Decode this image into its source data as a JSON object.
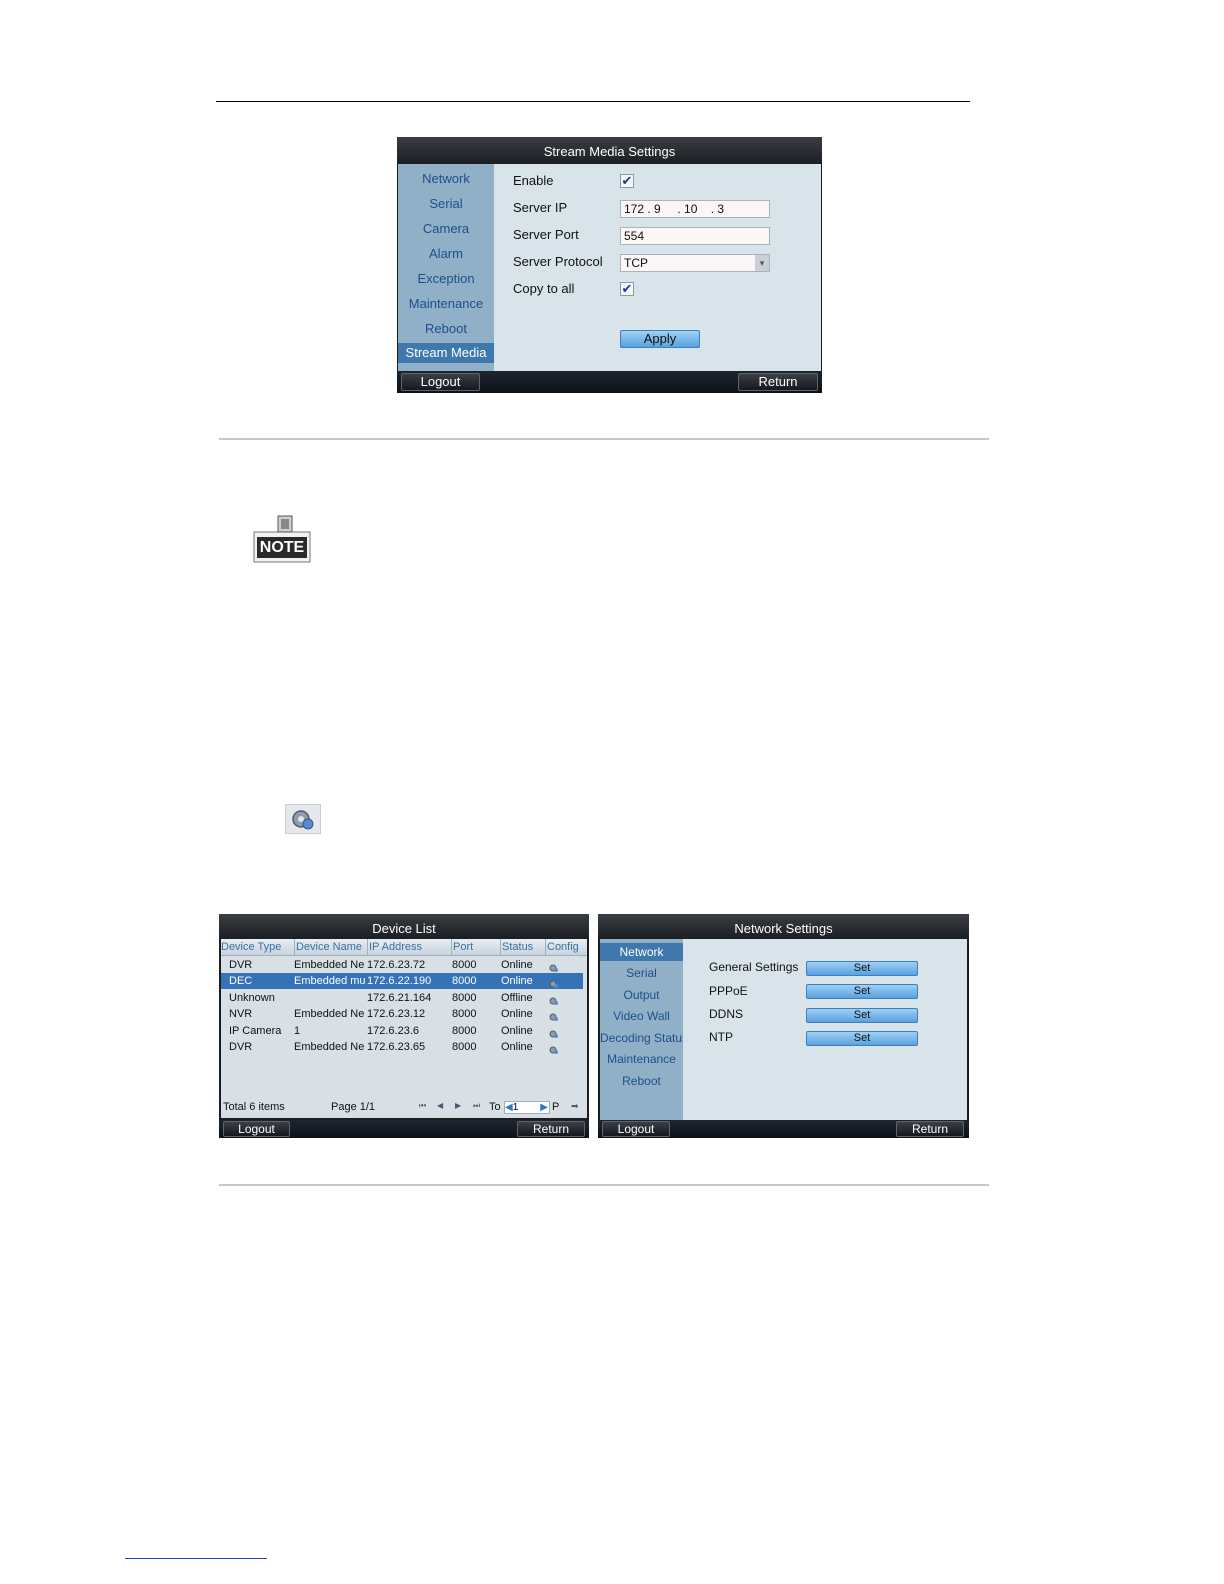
{
  "stream_media_dialog": {
    "title": "Stream Media Settings",
    "nav": [
      "Network",
      "Serial",
      "Camera",
      "Alarm",
      "Exception",
      "Maintenance",
      "Reboot",
      "Stream Media"
    ],
    "active_nav": "Stream Media",
    "fields": {
      "enable_label": "Enable",
      "server_ip_label": "Server IP",
      "server_ip_value": "172 . 9     . 10    . 3",
      "server_port_label": "Server Port",
      "server_port_value": "554",
      "server_protocol_label": "Server Protocol",
      "server_protocol_value": "TCP",
      "copy_to_all_label": "Copy to all"
    },
    "enable_checked": true,
    "copy_to_all_checked": true,
    "apply_label": "Apply",
    "logout_label": "Logout",
    "return_label": "Return"
  },
  "note_icon": {
    "icon": "note-icon",
    "text": "NOTE"
  },
  "config_icon": {
    "icon": "gear-globe-icon"
  },
  "device_list_dialog": {
    "title": "Device List",
    "columns": [
      "Device Type",
      "Device Name",
      "IP Address",
      "Port",
      "Status",
      "Config"
    ],
    "rows": [
      {
        "type": "DVR",
        "name": "Embedded Ne",
        "ip": "172.6.23.72",
        "port": "8000",
        "status": "Online",
        "selected": false
      },
      {
        "type": "DEC",
        "name": "Embedded mu",
        "ip": "172.6.22.190",
        "port": "8000",
        "status": "Online",
        "selected": true
      },
      {
        "type": "Unknown",
        "name": "",
        "ip": "172.6.21.164",
        "port": "8000",
        "status": "Offline",
        "selected": false
      },
      {
        "type": "NVR",
        "name": "Embedded Ne",
        "ip": "172.6.23.12",
        "port": "8000",
        "status": "Online",
        "selected": false
      },
      {
        "type": "IP Camera",
        "name": "1",
        "ip": "172.6.23.6",
        "port": "8000",
        "status": "Online",
        "selected": false
      },
      {
        "type": "DVR",
        "name": "Embedded Ne",
        "ip": "172.6.23.65",
        "port": "8000",
        "status": "Online",
        "selected": false
      }
    ],
    "total_label": "Total 6 items",
    "page_label": "Page 1/1",
    "to_label": "To",
    "page_input": "1",
    "p_label": "P",
    "logout_label": "Logout",
    "return_label": "Return"
  },
  "network_dialog": {
    "title": "Network Settings",
    "nav": [
      "Network",
      "Serial",
      "Output",
      "Video Wall",
      "Decoding Status",
      "Maintenance",
      "Reboot"
    ],
    "active_nav": "Network",
    "settings": [
      {
        "label": "General Settings",
        "button": "Set"
      },
      {
        "label": "PPPoE",
        "button": "Set"
      },
      {
        "label": "DDNS",
        "button": "Set"
      },
      {
        "label": "NTP",
        "button": "Set"
      }
    ],
    "logout_label": "Logout",
    "return_label": "Return"
  }
}
